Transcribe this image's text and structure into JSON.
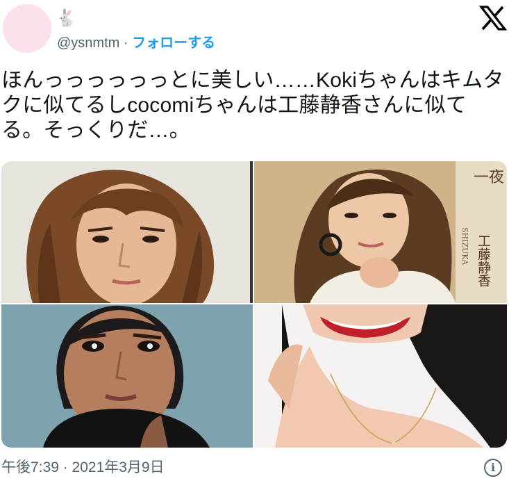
{
  "tweet": {
    "display_name": "🐇",
    "handle": "@ysnmtm",
    "separator": " · ",
    "follow_label": "フォローする",
    "text": "ほんっっっっっっとに美しい……Kokiちゃんはキムタクに似てるしcocomiちゃんは工藤静香さんに似てる。そっくりだ…。",
    "timestamp": "午後7:39 · 2021年3月9日",
    "info_glyph": "i"
  },
  "media": {
    "album_title": "一夜",
    "album_artist_en": "SHIZUKA",
    "album_artist_jp": "工藤静香"
  },
  "colors": {
    "follow_blue": "#1d9bf0",
    "text": "#0f1419",
    "secondary": "#536471",
    "avatar_pink": "#fbe0ee"
  }
}
